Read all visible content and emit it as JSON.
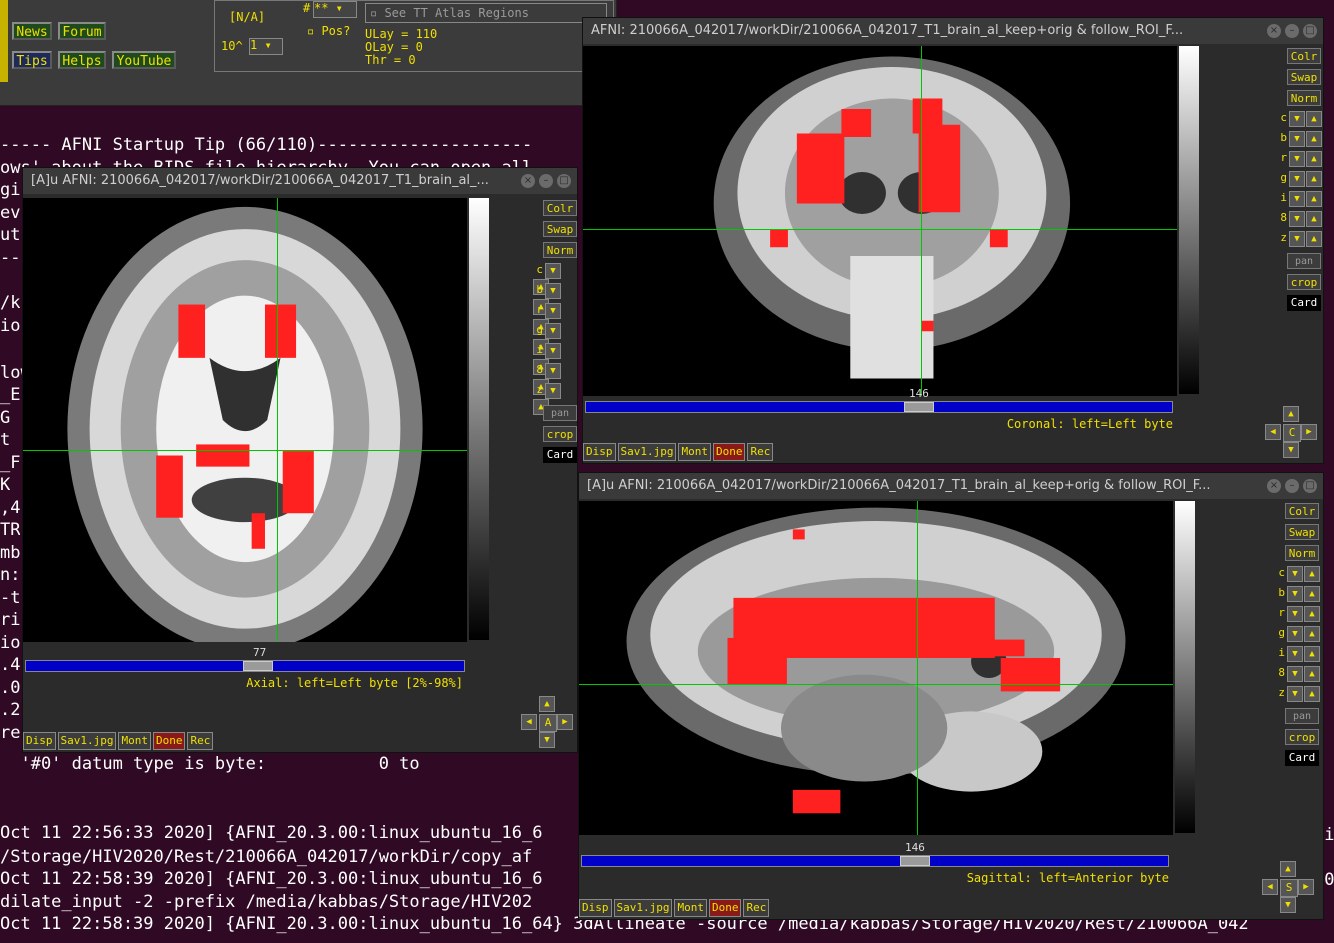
{
  "terminal": {
    "lines": [
      {
        "text": "----- AFNI Startup Tip (66/110)---------------------"
      },
      {
        "text": "ows' about the BIDS file hierarchy. You can open all"
      },
      {
        "text": "gi"
      },
      {
        "text": "ev"
      },
      {
        "text": "ut"
      },
      {
        "text": "--"
      },
      {
        "text": "/k"
      },
      {
        "text": "io"
      },
      {
        "text": ""
      },
      {
        "text": "low"
      },
      {
        "text": "_E"
      },
      {
        "text": "G"
      },
      {
        "text": "t"
      },
      {
        "text": "_F"
      },
      {
        "text": "K"
      },
      {
        "text": ",4"
      },
      {
        "text": "TR"
      },
      {
        "text": "mb"
      },
      {
        "text": "n:"
      },
      {
        "text": "-t"
      },
      {
        "text": "ri"
      },
      {
        "text": "io"
      },
      {
        "text": ".4"
      },
      {
        "text": ".0"
      },
      {
        "text": ".2"
      },
      {
        "text": "re"
      },
      {
        "text": "  '#0' datum type is byte:           0 to"
      },
      {
        "text": ""
      },
      {
        "text": ""
      },
      {
        "text": "Oct 11 22:56:33 2020] {AFNI_20.3.00:linux_ubuntu_16_6"
      },
      {
        "text": "/Storage/HIV2020/Rest/210066A_042017/workDir/copy_af"
      },
      {
        "text": "Oct 11 22:58:39 2020] {AFNI_20.3.00:linux_ubuntu_16_6"
      },
      {
        "text": "dilate_input -2 -prefix /media/kabbas/Storage/HIV202"
      },
      {
        "text": "Oct 11 22:58:39 2020] {AFNI_20.3.00:linux_ubuntu_16_64} 3dAllineate -source /media/kabbas/Storage/HIV2020/Rest/210066A_042"
      }
    ],
    "right_fragments": [
      "ri",
      "20"
    ]
  },
  "controller": {
    "buttons": [
      "News",
      "Forum",
      "Tips",
      "Helps",
      "YouTube"
    ],
    "na_label": "[N/A]",
    "power_label": "10^",
    "power_value": "1",
    "hash_label": "#",
    "hash_value": "**",
    "pos_label": "Pos?",
    "see_tt_label": "See TT Atlas Regions",
    "ulay": "ULay = 110",
    "olay": "OLay = 0",
    "thr": "Thr  = 0"
  },
  "side_buttons": {
    "colr": "Colr",
    "swap": "Swap",
    "norm": "Norm",
    "rows": [
      "c",
      "b",
      "r",
      "g",
      "i",
      "8",
      "z"
    ],
    "pan": "pan",
    "crop": "crop",
    "card": "Card"
  },
  "bottom_buttons": [
    "Disp",
    "Sav1.jpg",
    "Mont",
    "Done",
    "Rec"
  ],
  "windows": {
    "axial": {
      "title": "[A]u AFNI: 210066A_042017/workDir/210066A_042017_T1_brain_al_...",
      "slice": "77",
      "slice_fraction": 0.53,
      "label": "Axial: left=Left byte [2%-98%]",
      "nav_center": "A"
    },
    "coronal": {
      "title": "AFNI: 210066A_042017/workDir/210066A_042017_T1_brain_al_keep+orig & follow_ROI_F...",
      "slice": "146",
      "slice_fraction": 0.57,
      "label": "Coronal: left=Left byte",
      "nav_center": "C"
    },
    "sagittal": {
      "title": "[A]u AFNI: 210066A_042017/workDir/210066A_042017_T1_brain_al_keep+orig & follow_ROI_F...",
      "slice": "146",
      "slice_fraction": 0.57,
      "label": "Sagittal: left=Anterior byte",
      "nav_center": "S"
    }
  },
  "colors": {
    "overlay": "#ff2020",
    "crosshair": "#00c800",
    "slider": "#0000c8",
    "label": "#f0e000"
  }
}
